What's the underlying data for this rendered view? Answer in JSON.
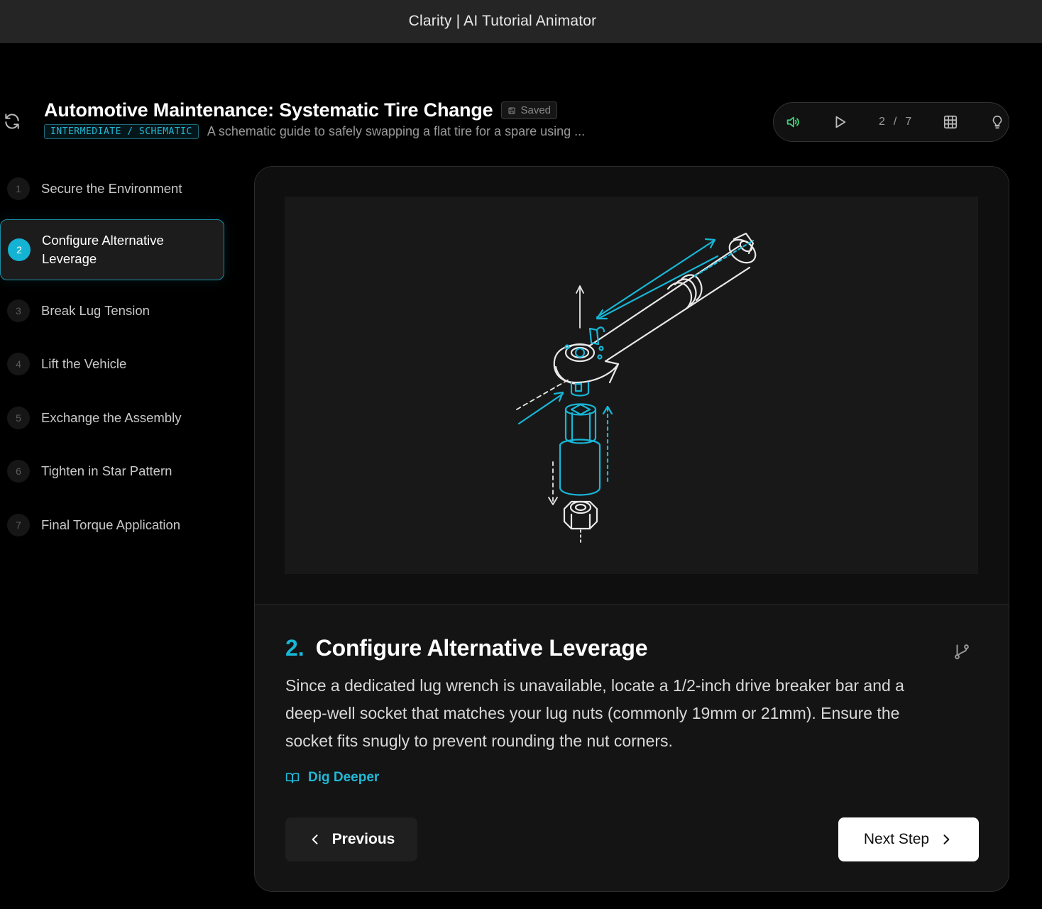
{
  "app": {
    "title": "Clarity | AI Tutorial Animator"
  },
  "tutorial": {
    "title": "Automotive Maintenance: Systematic Tire Change",
    "saved_label": "Saved",
    "tag": "INTERMEDIATE / SCHEMATIC",
    "subtitle": "A schematic guide to safely swapping a flat tire for a spare using ..."
  },
  "controls": {
    "current": "2",
    "separator": "/",
    "total": "7"
  },
  "steps": [
    {
      "num": "1",
      "label": "Secure the Environment"
    },
    {
      "num": "2",
      "label": "Configure Alternative Leverage",
      "active": true
    },
    {
      "num": "3",
      "label": "Break Lug Tension"
    },
    {
      "num": "4",
      "label": "Lift the Vehicle"
    },
    {
      "num": "5",
      "label": "Exchange the Assembly"
    },
    {
      "num": "6",
      "label": "Tighten in Star Pattern"
    },
    {
      "num": "7",
      "label": "Final Torque Application"
    }
  ],
  "current_step": {
    "number": "2.",
    "title": "Configure Alternative Leverage",
    "description": "Since a dedicated lug wrench is unavailable, locate a 1/2-inch drive breaker bar and a deep-well socket that matches your lug nuts (commonly 19mm or 21mm). Ensure the socket fits snugly to prevent rounding the nut corners.",
    "dig_deeper_label": "Dig Deeper"
  },
  "nav": {
    "previous_label": "Previous",
    "next_label": "Next Step"
  },
  "colors": {
    "accent": "#18b6d6",
    "background": "#000000",
    "panel": "#141414"
  },
  "icons": [
    "refresh-icon",
    "save-icon",
    "volume-icon",
    "play-icon",
    "grid-icon",
    "lightbulb-icon",
    "branch-icon",
    "book-icon",
    "chevron-left-icon",
    "chevron-right-icon"
  ]
}
